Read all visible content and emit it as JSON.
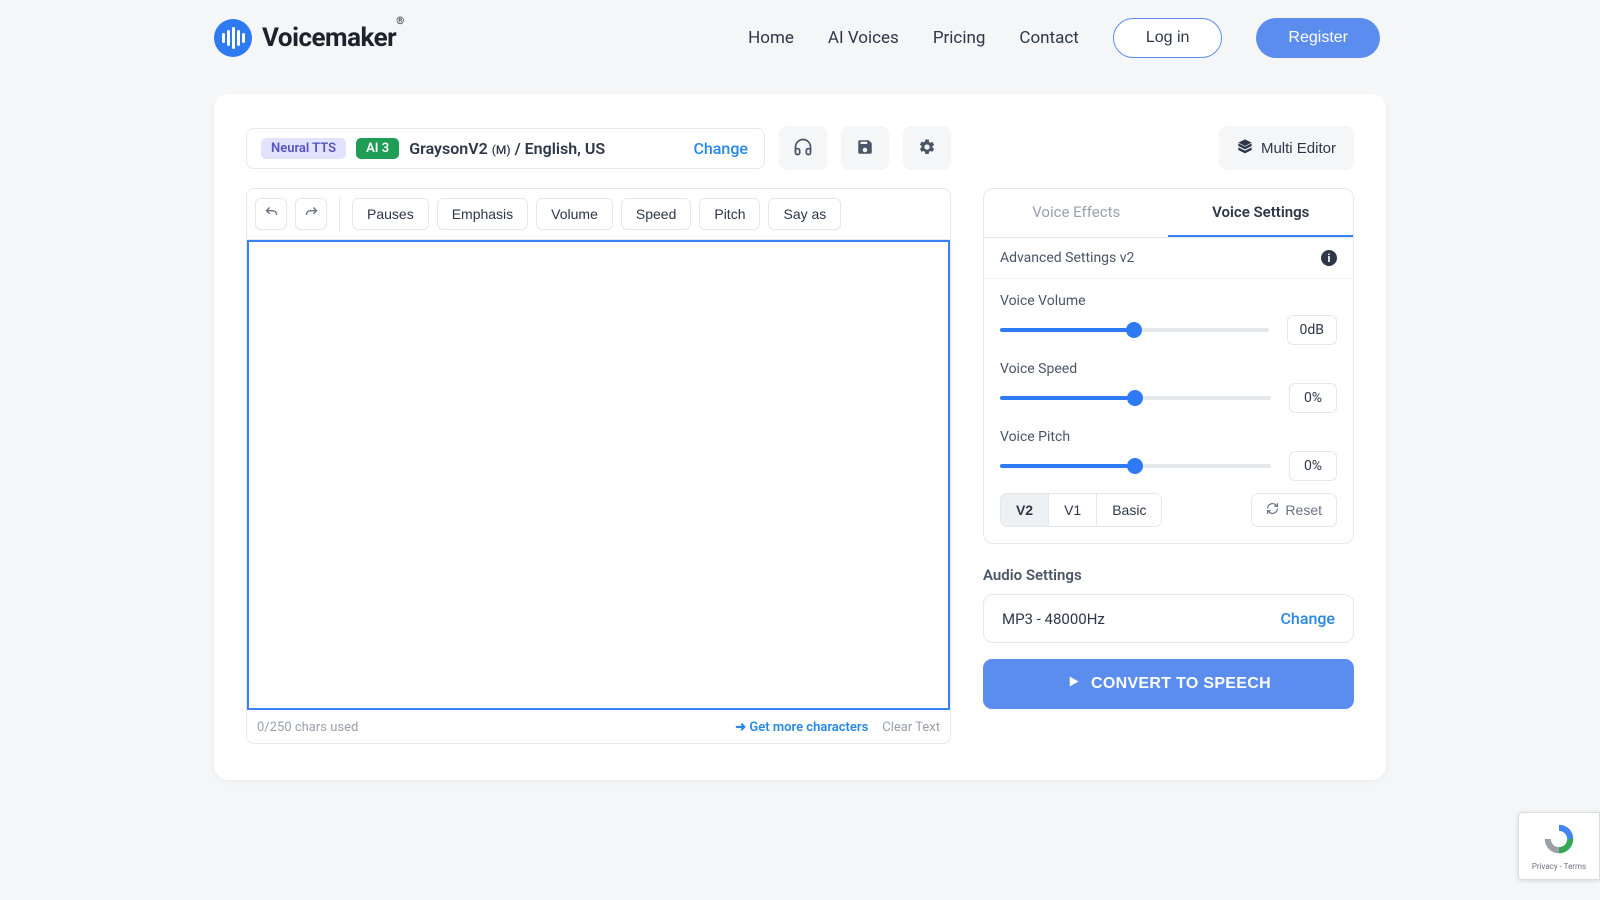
{
  "brand": {
    "name": "Voicemaker",
    "reg": "®"
  },
  "nav": {
    "home": "Home",
    "ai_voices": "AI Voices",
    "pricing": "Pricing",
    "contact": "Contact",
    "login": "Log in",
    "register": "Register"
  },
  "voice_bar": {
    "badge_neural": "Neural TTS",
    "badge_ai": "AI 3",
    "voice_name": "GraysonV2",
    "gender": "(M)",
    "lang": " / English, US",
    "change": "Change"
  },
  "multi_editor": "Multi Editor",
  "toolbar": {
    "pauses": "Pauses",
    "emphasis": "Emphasis",
    "volume": "Volume",
    "speed": "Speed",
    "pitch": "Pitch",
    "say_as": "Say as"
  },
  "editor": {
    "char_counter": "0/250 chars used",
    "get_more": "Get more characters",
    "clear": "Clear Text"
  },
  "tabs": {
    "effects": "Voice Effects",
    "settings": "Voice Settings"
  },
  "advanced_label": "Advanced Settings v2",
  "sliders": {
    "volume": {
      "label": "Voice Volume",
      "value": "0dB"
    },
    "speed": {
      "label": "Voice Speed",
      "value": "0%"
    },
    "pitch": {
      "label": "Voice Pitch",
      "value": "0%"
    }
  },
  "versions": {
    "v2": "V2",
    "v1": "V1",
    "basic": "Basic"
  },
  "reset": "Reset",
  "audio": {
    "title": "Audio Settings",
    "format": "MP3 - 48000Hz",
    "change": "Change"
  },
  "convert": "CONVERT TO SPEECH",
  "recaptcha": "Privacy - Terms"
}
